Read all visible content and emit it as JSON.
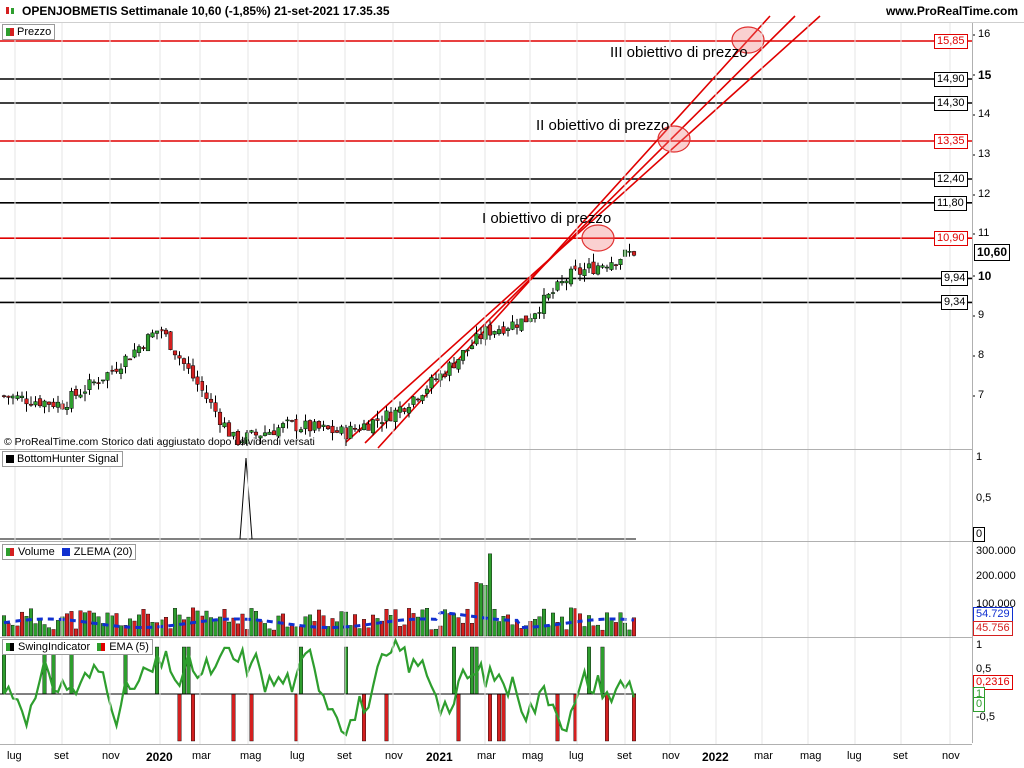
{
  "header": {
    "title": "OPENJOBMETIS Settimanale 10,60 (-1,85%) 21-set-2021 17.35.35",
    "site": "www.ProRealTime.com"
  },
  "copyright": "© ProRealTime.com  Storico dati aggiustato dopo i dividendi versati",
  "panels": {
    "price": {
      "legend": "Prezzo",
      "last_price": "10,60",
      "axis_ticks": [
        {
          "v": 16,
          "label": "16",
          "bold": false
        },
        {
          "v": 15,
          "label": "15",
          "bold": true
        },
        {
          "v": 14,
          "label": "14",
          "bold": false
        },
        {
          "v": 13,
          "label": "13",
          "bold": false
        },
        {
          "v": 12,
          "label": "12",
          "bold": false
        },
        {
          "v": 11,
          "label": "11",
          "bold": false
        },
        {
          "v": 10,
          "label": "10",
          "bold": true
        },
        {
          "v": 9,
          "label": "9",
          "bold": false
        },
        {
          "v": 8,
          "label": "8",
          "bold": false
        },
        {
          "v": 7,
          "label": "7",
          "bold": false
        }
      ],
      "levels": [
        {
          "v": 15.85,
          "label": "15,85",
          "color": "#e00000"
        },
        {
          "v": 14.9,
          "label": "14,90",
          "color": "#000000"
        },
        {
          "v": 14.3,
          "label": "14,30",
          "color": "#000000"
        },
        {
          "v": 13.35,
          "label": "13,35",
          "color": "#e00000"
        },
        {
          "v": 12.4,
          "label": "12,40",
          "color": "#000000"
        },
        {
          "v": 11.8,
          "label": "11,80",
          "color": "#000000"
        },
        {
          "v": 10.9,
          "label": "10,90",
          "color": "#e00000"
        },
        {
          "v": 9.94,
          "label": "9,94",
          "color": "#000000"
        },
        {
          "v": 9.34,
          "label": "9,34",
          "color": "#000000"
        }
      ],
      "annotations": {
        "target1": "I obiettivo di prezzo",
        "target2": "II obiettivo di prezzo",
        "target3": "III obiettivo di prezzo"
      }
    },
    "bottomhunter": {
      "legend": "BottomHunter Signal",
      "axis_ticks": [
        {
          "v": 1,
          "label": "1"
        },
        {
          "v": 0.5,
          "label": "0,5"
        }
      ],
      "last_value": "0"
    },
    "volume": {
      "legend_volume": "Volume",
      "legend_zlema": "ZLEMA (20)",
      "axis_ticks": [
        {
          "v": 300000,
          "label": "300.000"
        },
        {
          "v": 200000,
          "label": "200.000"
        },
        {
          "v": 100000,
          "label": "100.000"
        }
      ],
      "zlema_value": "54.729",
      "volume_value": "45.756"
    },
    "swing": {
      "legend_swing": "SwingIndicator",
      "legend_ema": "EMA (5)",
      "axis_ticks": [
        {
          "v": 1,
          "label": "1"
        },
        {
          "v": 0.5,
          "label": "0,5"
        },
        {
          "v": -0.5,
          "label": "-0,5"
        }
      ],
      "ema_value": "0,2316",
      "swing_values": [
        "1",
        "0"
      ]
    }
  },
  "x_axis": [
    {
      "label": "lug",
      "bold": false
    },
    {
      "label": "set",
      "bold": false
    },
    {
      "label": "nov",
      "bold": false
    },
    {
      "label": "2020",
      "bold": true
    },
    {
      "label": "mar",
      "bold": false
    },
    {
      "label": "mag",
      "bold": false
    },
    {
      "label": "lug",
      "bold": false
    },
    {
      "label": "set",
      "bold": false
    },
    {
      "label": "nov",
      "bold": false
    },
    {
      "label": "2021",
      "bold": true
    },
    {
      "label": "mar",
      "bold": false
    },
    {
      "label": "mag",
      "bold": false
    },
    {
      "label": "lug",
      "bold": false
    },
    {
      "label": "set",
      "bold": false
    },
    {
      "label": "nov",
      "bold": false
    },
    {
      "label": "2022",
      "bold": true
    },
    {
      "label": "mar",
      "bold": false
    },
    {
      "label": "mag",
      "bold": false
    },
    {
      "label": "lug",
      "bold": false
    },
    {
      "label": "set",
      "bold": false
    },
    {
      "label": "nov",
      "bold": false
    }
  ],
  "colors": {
    "up": "#2e9e2e",
    "down": "#d42020",
    "level_red": "#e00000",
    "zlema": "#1030d0",
    "ema": "#e00000",
    "bg": "#ffffff"
  },
  "chart_data": {
    "type": "candlestick",
    "title": "OPENJOBMETIS Settimanale",
    "price_close_path": [
      {
        "x": "lug 2019",
        "y": 7.0
      },
      {
        "x": "set 2019",
        "y": 6.8
      },
      {
        "x": "nov 2019",
        "y": 7.6
      },
      {
        "x": "dic 2019",
        "y": 8.7
      },
      {
        "x": "feb 2020",
        "y": 7.2
      },
      {
        "x": "mar 2020",
        "y": 5.9
      },
      {
        "x": "giu 2020",
        "y": 6.3
      },
      {
        "x": "set 2020",
        "y": 6.1
      },
      {
        "x": "nov 2020",
        "y": 6.6
      },
      {
        "x": "gen 2021",
        "y": 7.5
      },
      {
        "x": "mar 2021",
        "y": 8.6
      },
      {
        "x": "mag 2021",
        "y": 8.9
      },
      {
        "x": "lug 2021",
        "y": 10.0
      },
      {
        "x": "set 2021",
        "y": 10.6
      }
    ],
    "levels": [
      15.85,
      14.9,
      14.3,
      13.35,
      12.4,
      11.8,
      10.9,
      9.94,
      9.34
    ],
    "ylim": [
      5.9,
      16.4
    ]
  }
}
